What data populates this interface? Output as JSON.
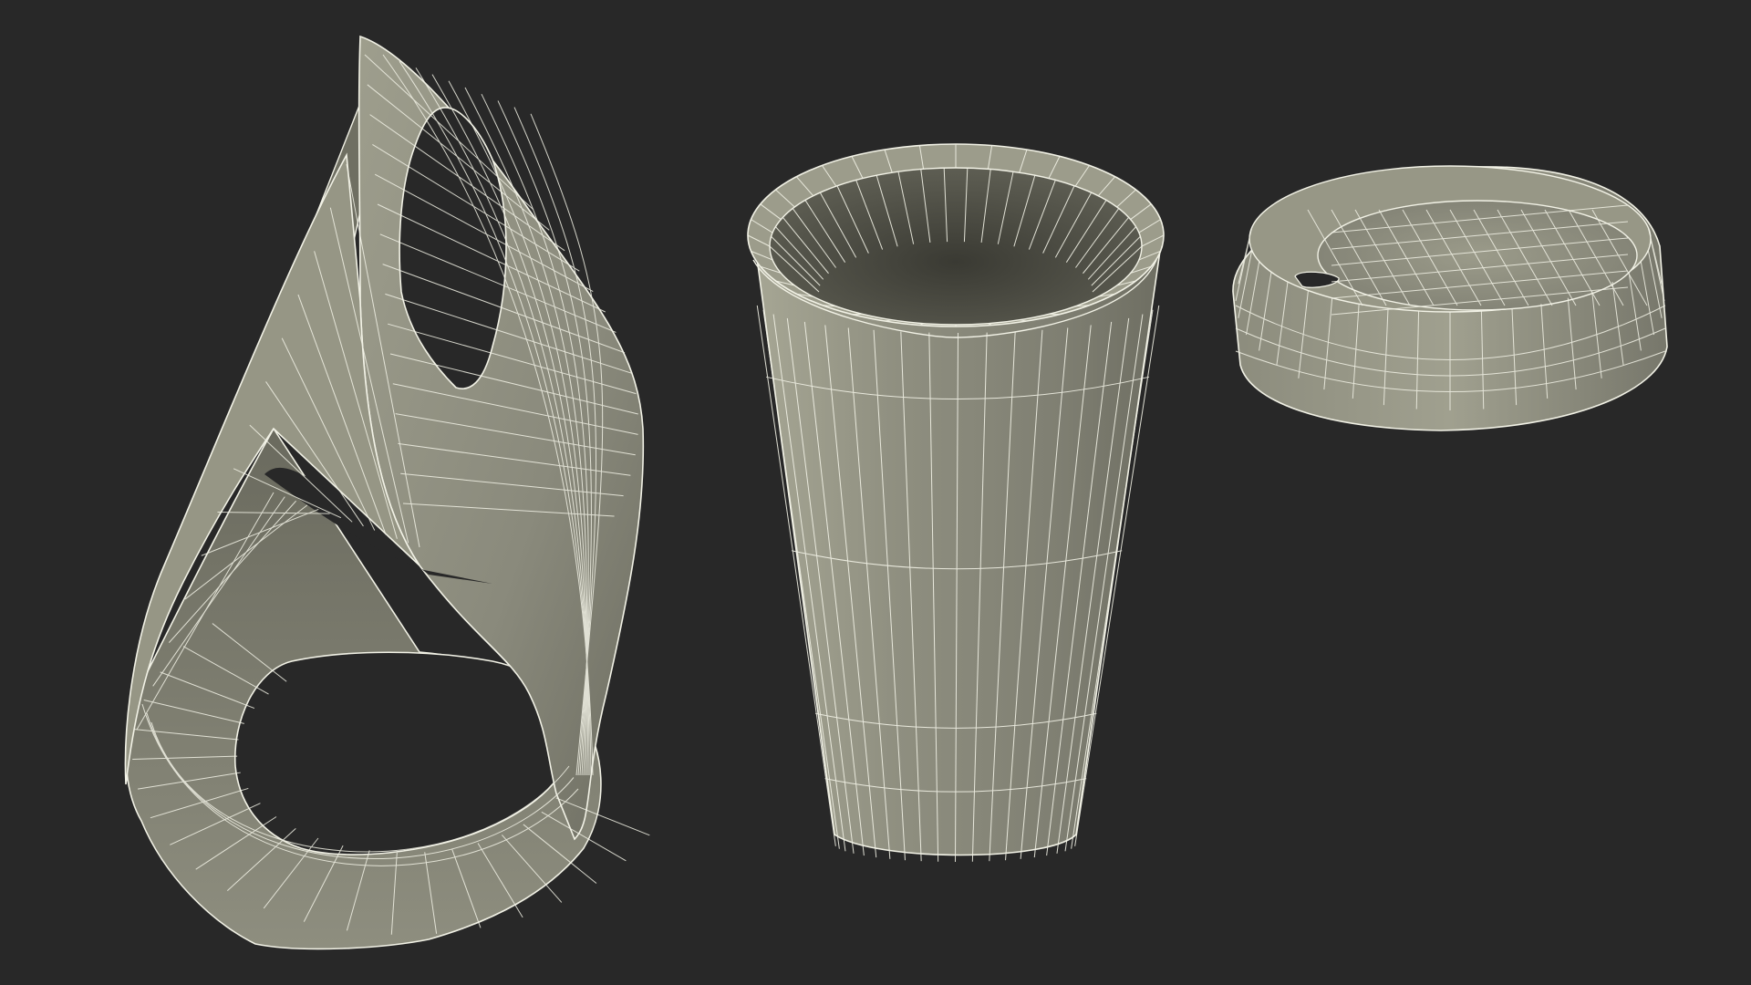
{
  "scene": {
    "background_color": "#282828",
    "surface_color": "#8a8a7c",
    "surface_light_color": "#a3a392",
    "surface_dark_color": "#5b5b4f",
    "inner_color": "#3e3e36",
    "wire_color": "#f2f2e6",
    "objects": [
      {
        "name": "cup-holder-sleeve",
        "description": ""
      },
      {
        "name": "paper-cup",
        "description": ""
      },
      {
        "name": "cup-lid",
        "description": ""
      }
    ]
  }
}
